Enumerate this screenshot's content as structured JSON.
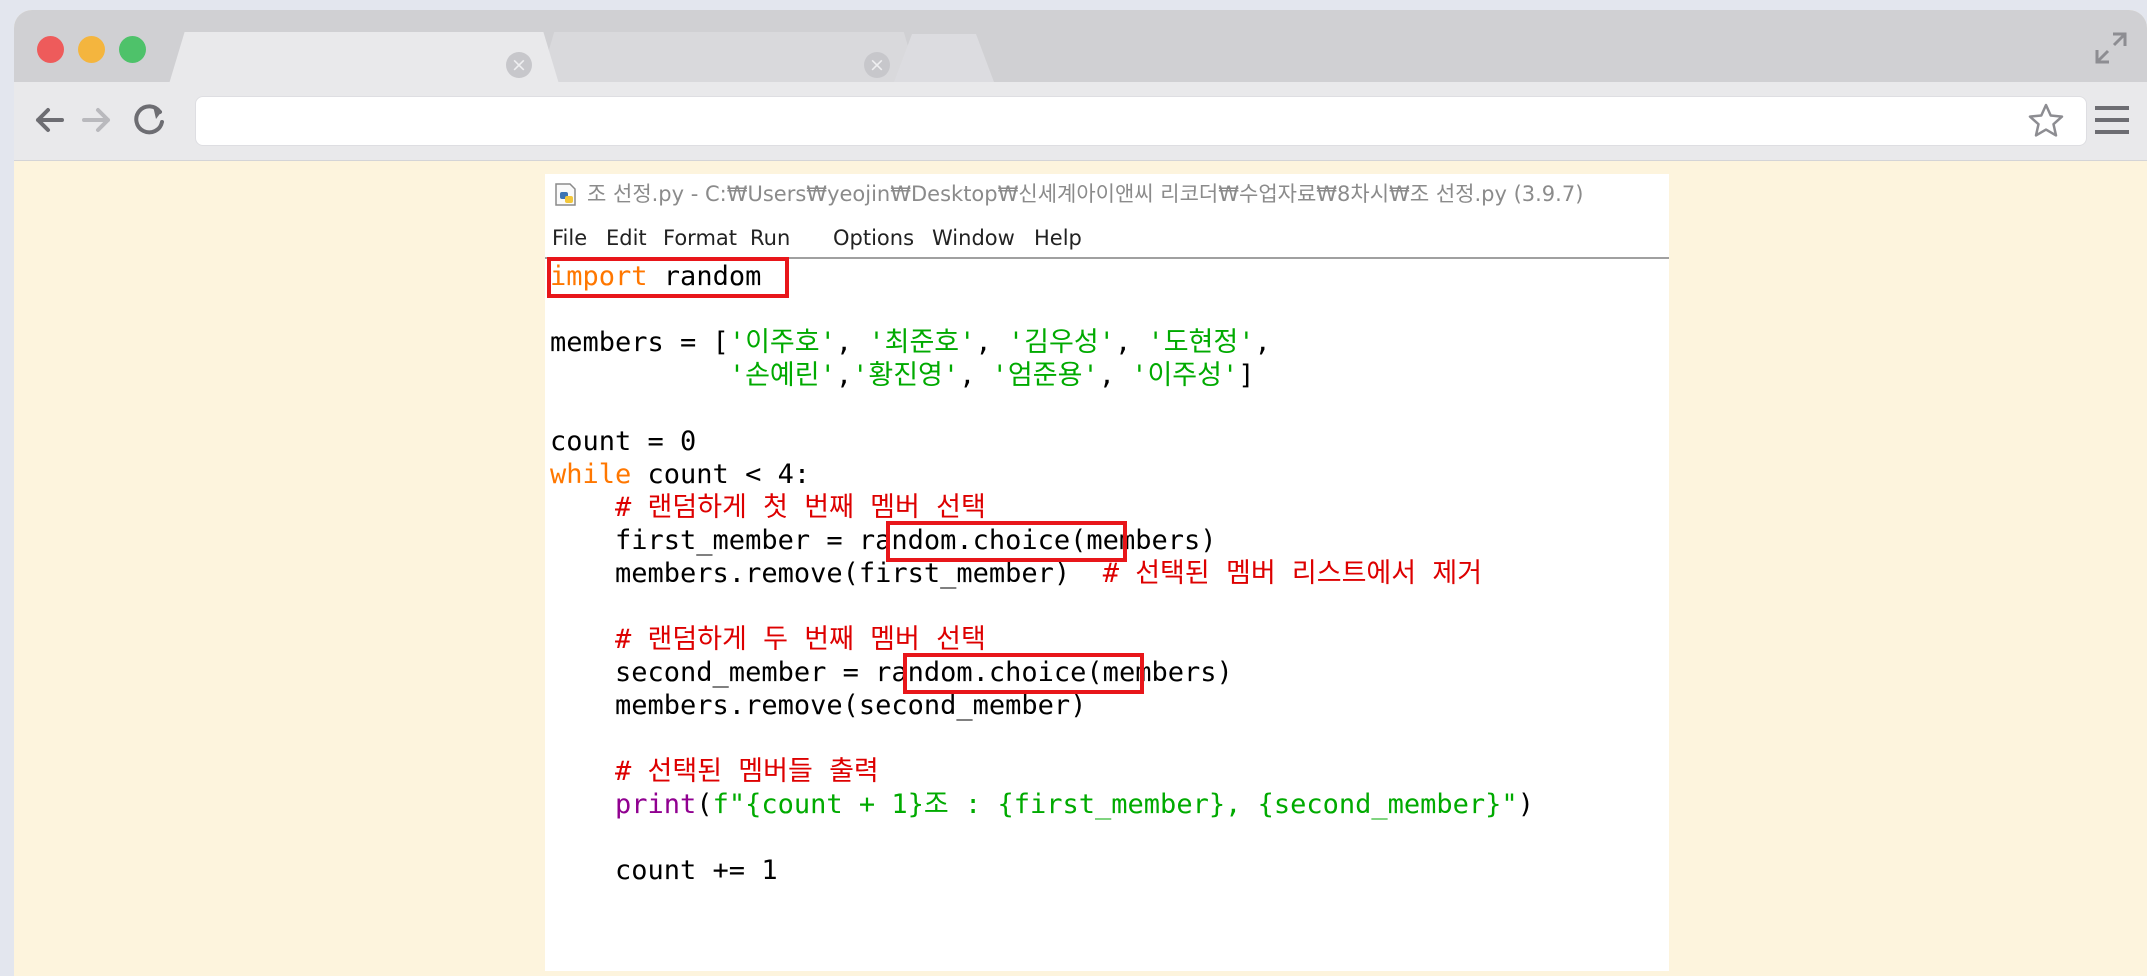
{
  "window": {
    "title": "조 선정.py - C:₩Users₩yeojin₩Desktop₩신세계아이앤씨 리코더₩수업자료₩8차시₩조 선정.py (3.9.7)"
  },
  "menu": {
    "file": "File",
    "edit": "Edit",
    "format": "Format",
    "run": "Run",
    "options": "Options",
    "window": "Window",
    "help": "Help"
  },
  "code": {
    "l1_kw": "import",
    "l1_rest": " random",
    "l3_a": "members = [",
    "l3_s1": "'이주호'",
    "l3_sep1": ", ",
    "l3_s2": "'최준호'",
    "l3_sep2": ", ",
    "l3_s3": "'김우성'",
    "l3_sep3": ", ",
    "l3_s4": "'도현정'",
    "l3_end": ",",
    "l4_indent": "           ",
    "l4_s1": "'손예린'",
    "l4_sep1": ",",
    "l4_s2": "'황진영'",
    "l4_sep2": ", ",
    "l4_s3": "'엄준용'",
    "l4_sep3": ", ",
    "l4_s4": "'이주성'",
    "l4_end": "]",
    "l6": "count = 0",
    "l7_kw": "while",
    "l7_rest": " count < 4:",
    "l8_cmt": "    # 랜덤하게 첫 번째 멤버 선택",
    "l9": "    first_member = random.choice(members)",
    "l10_code": "    members.remove(first_member)  ",
    "l10_cmt": "# 선택된 멤버 리스트에서 제거",
    "l12_cmt": "    # 랜덤하게 두 번째 멤버 선택",
    "l13": "    second_member = random.choice(members)",
    "l14": "    members.remove(second_member)",
    "l16_cmt": "    # 선택된 멤버들 출력",
    "l17_indent": "    ",
    "l17_bi": "print",
    "l17_open": "(",
    "l17_str": "f\"{count + 1}조 : {first_member}, {second_member}\"",
    "l17_close": ")",
    "l19": "    count += 1"
  },
  "colors": {
    "keyword": "#ff7700",
    "string": "#00aa00",
    "comment": "#dd0000",
    "builtin": "#900090",
    "highlight_box": "#e8161a"
  },
  "icons": [
    "back-arrow-icon",
    "forward-arrow-icon",
    "reload-icon",
    "star-icon",
    "menu-icon",
    "expand-icon",
    "tab-close-icon",
    "python-file-icon"
  ]
}
